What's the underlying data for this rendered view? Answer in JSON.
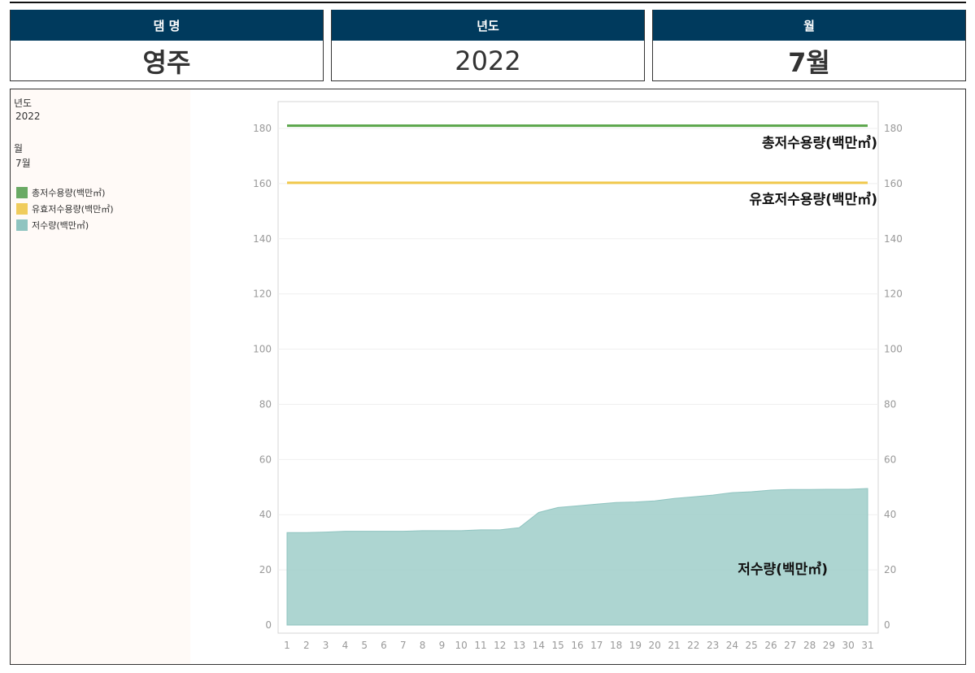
{
  "header": {
    "cards": [
      {
        "label": "댐 명",
        "value": "영주"
      },
      {
        "label": "년도",
        "value": "2022"
      },
      {
        "label": "월",
        "value": "7월"
      }
    ]
  },
  "sidebar": {
    "year_label": "년도",
    "year_value": "2022",
    "month_label": "월",
    "month_value": "7월",
    "legend": [
      {
        "label": "총저수용량(백만㎥)",
        "color": "#6aaa64"
      },
      {
        "label": "유효저수용량(백만㎥)",
        "color": "#f0cc5c"
      },
      {
        "label": "저수량(백만㎥)",
        "color": "#8fc4c0"
      }
    ]
  },
  "chart_data": {
    "type": "area",
    "x": [
      1,
      2,
      3,
      4,
      5,
      6,
      7,
      8,
      9,
      10,
      11,
      12,
      13,
      14,
      15,
      16,
      17,
      18,
      19,
      20,
      21,
      22,
      23,
      24,
      25,
      26,
      27,
      28,
      29,
      30,
      31
    ],
    "xlim": [
      1,
      31
    ],
    "ylim": [
      0,
      190
    ],
    "yticks": [
      0,
      20,
      40,
      60,
      80,
      100,
      120,
      140,
      160,
      180
    ],
    "grid": true,
    "legend_position": "left",
    "series": [
      {
        "name": "총저수용량(백만㎥)",
        "type": "line",
        "color": "#5aa54a",
        "values": [
          181,
          181,
          181,
          181,
          181,
          181,
          181,
          181,
          181,
          181,
          181,
          181,
          181,
          181,
          181,
          181,
          181,
          181,
          181,
          181,
          181,
          181,
          181,
          181,
          181,
          181,
          181,
          181,
          181,
          181,
          181
        ]
      },
      {
        "name": "유효저수용량(백만㎥)",
        "type": "line",
        "color": "#f0c84a",
        "values": [
          160.3,
          160.3,
          160.3,
          160.3,
          160.3,
          160.3,
          160.3,
          160.3,
          160.3,
          160.3,
          160.3,
          160.3,
          160.3,
          160.3,
          160.3,
          160.3,
          160.3,
          160.3,
          160.3,
          160.3,
          160.3,
          160.3,
          160.3,
          160.3,
          160.3,
          160.3,
          160.3,
          160.3,
          160.3,
          160.3,
          160.3
        ]
      },
      {
        "name": "저수량(백만㎥)",
        "type": "area",
        "color": "#a2cfcb",
        "values": [
          33.5,
          33.5,
          33.7,
          34,
          34,
          34,
          34,
          34.2,
          34.2,
          34.2,
          34.5,
          34.5,
          35.3,
          40.8,
          42.6,
          43.2,
          43.8,
          44.4,
          44.6,
          45,
          45.9,
          46.5,
          47.1,
          48,
          48.3,
          48.9,
          49.1,
          49.1,
          49.2,
          49.2,
          49.5
        ]
      }
    ]
  }
}
